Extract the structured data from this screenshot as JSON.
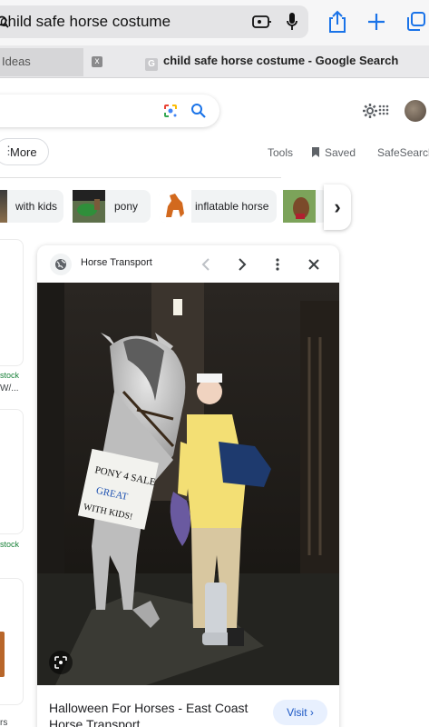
{
  "browser": {
    "url_query": "child safe horse costume",
    "tabs": {
      "inactive_label": "Ideas",
      "close_glyph": "x",
      "active_favicon": "G",
      "active_title": "child safe horse costume - Google Search"
    }
  },
  "google": {
    "more_label": "More",
    "tools_label": "Tools",
    "saved_label": "Saved",
    "safesearch_label": "SafeSearch"
  },
  "chips": [
    {
      "label": "with kids"
    },
    {
      "label": "pony"
    },
    {
      "label": "inflatable horse"
    }
  ],
  "left_results": {
    "stock_1": "stock",
    "snippet_1": "W/...",
    "stock_2": "stock",
    "snippet_3": "rs"
  },
  "preview": {
    "source": "Horse Transport",
    "sign_text_1": "PONY 4 SALE",
    "sign_text_2": "GREAT",
    "sign_text_3": "WITH KIDS!",
    "title": "Halloween For Horses - East Coast Horse Transport",
    "visit_label": "Visit ›"
  },
  "colors": {
    "accent_blue": "#1a73e8",
    "stock_green": "#188038"
  }
}
